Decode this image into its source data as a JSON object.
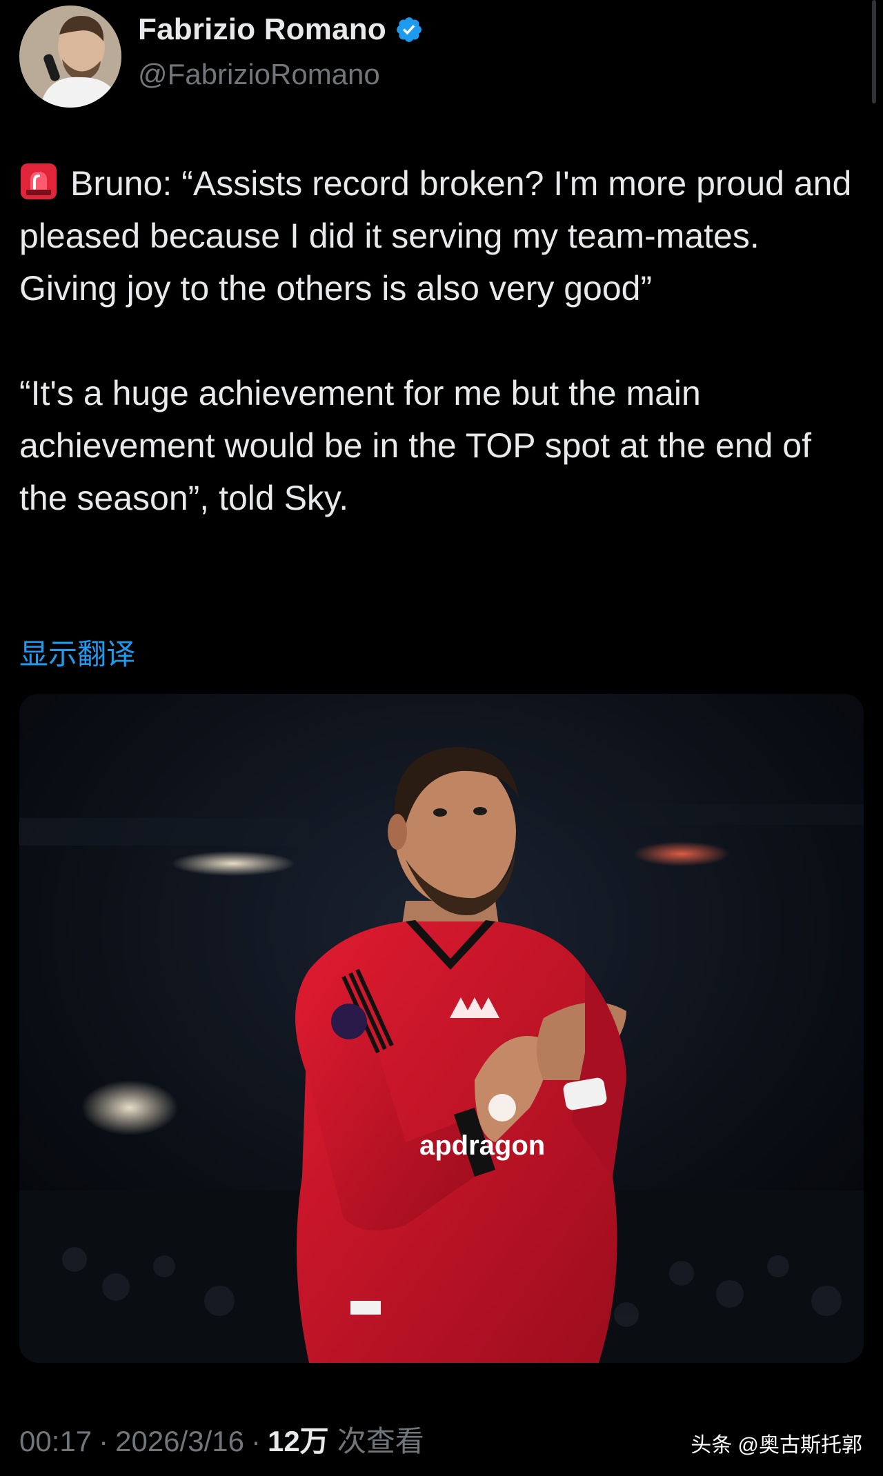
{
  "author": {
    "display_name": "Fabrizio Romano",
    "handle": "@FabrizioRomano",
    "verified": true,
    "verified_color": "#1d9bf0"
  },
  "tweet": {
    "lead_icon": "siren-icon",
    "paragraph_1": "Bruno: “Assists record broken? I'm more proud and pleased because I did it serving my team-mates. Giving joy to the others is also very good”",
    "paragraph_2": "“It's a huge achievement for me but the main achievement would be in the TOP spot at the end of the season”, told Sky.",
    "translate_label": "显示翻译"
  },
  "media": {
    "sponsor_text": "apdragon"
  },
  "meta": {
    "time": "00:17",
    "date": "2026/3/16",
    "separator": "·",
    "views_count": "12万",
    "views_label": "次查看"
  },
  "watermark": "头条 @奥古斯托郭",
  "colors": {
    "background": "#000000",
    "text": "#e7e9ea",
    "muted": "#71767b",
    "link": "#1d9bf0",
    "jersey": "#c8102e"
  }
}
